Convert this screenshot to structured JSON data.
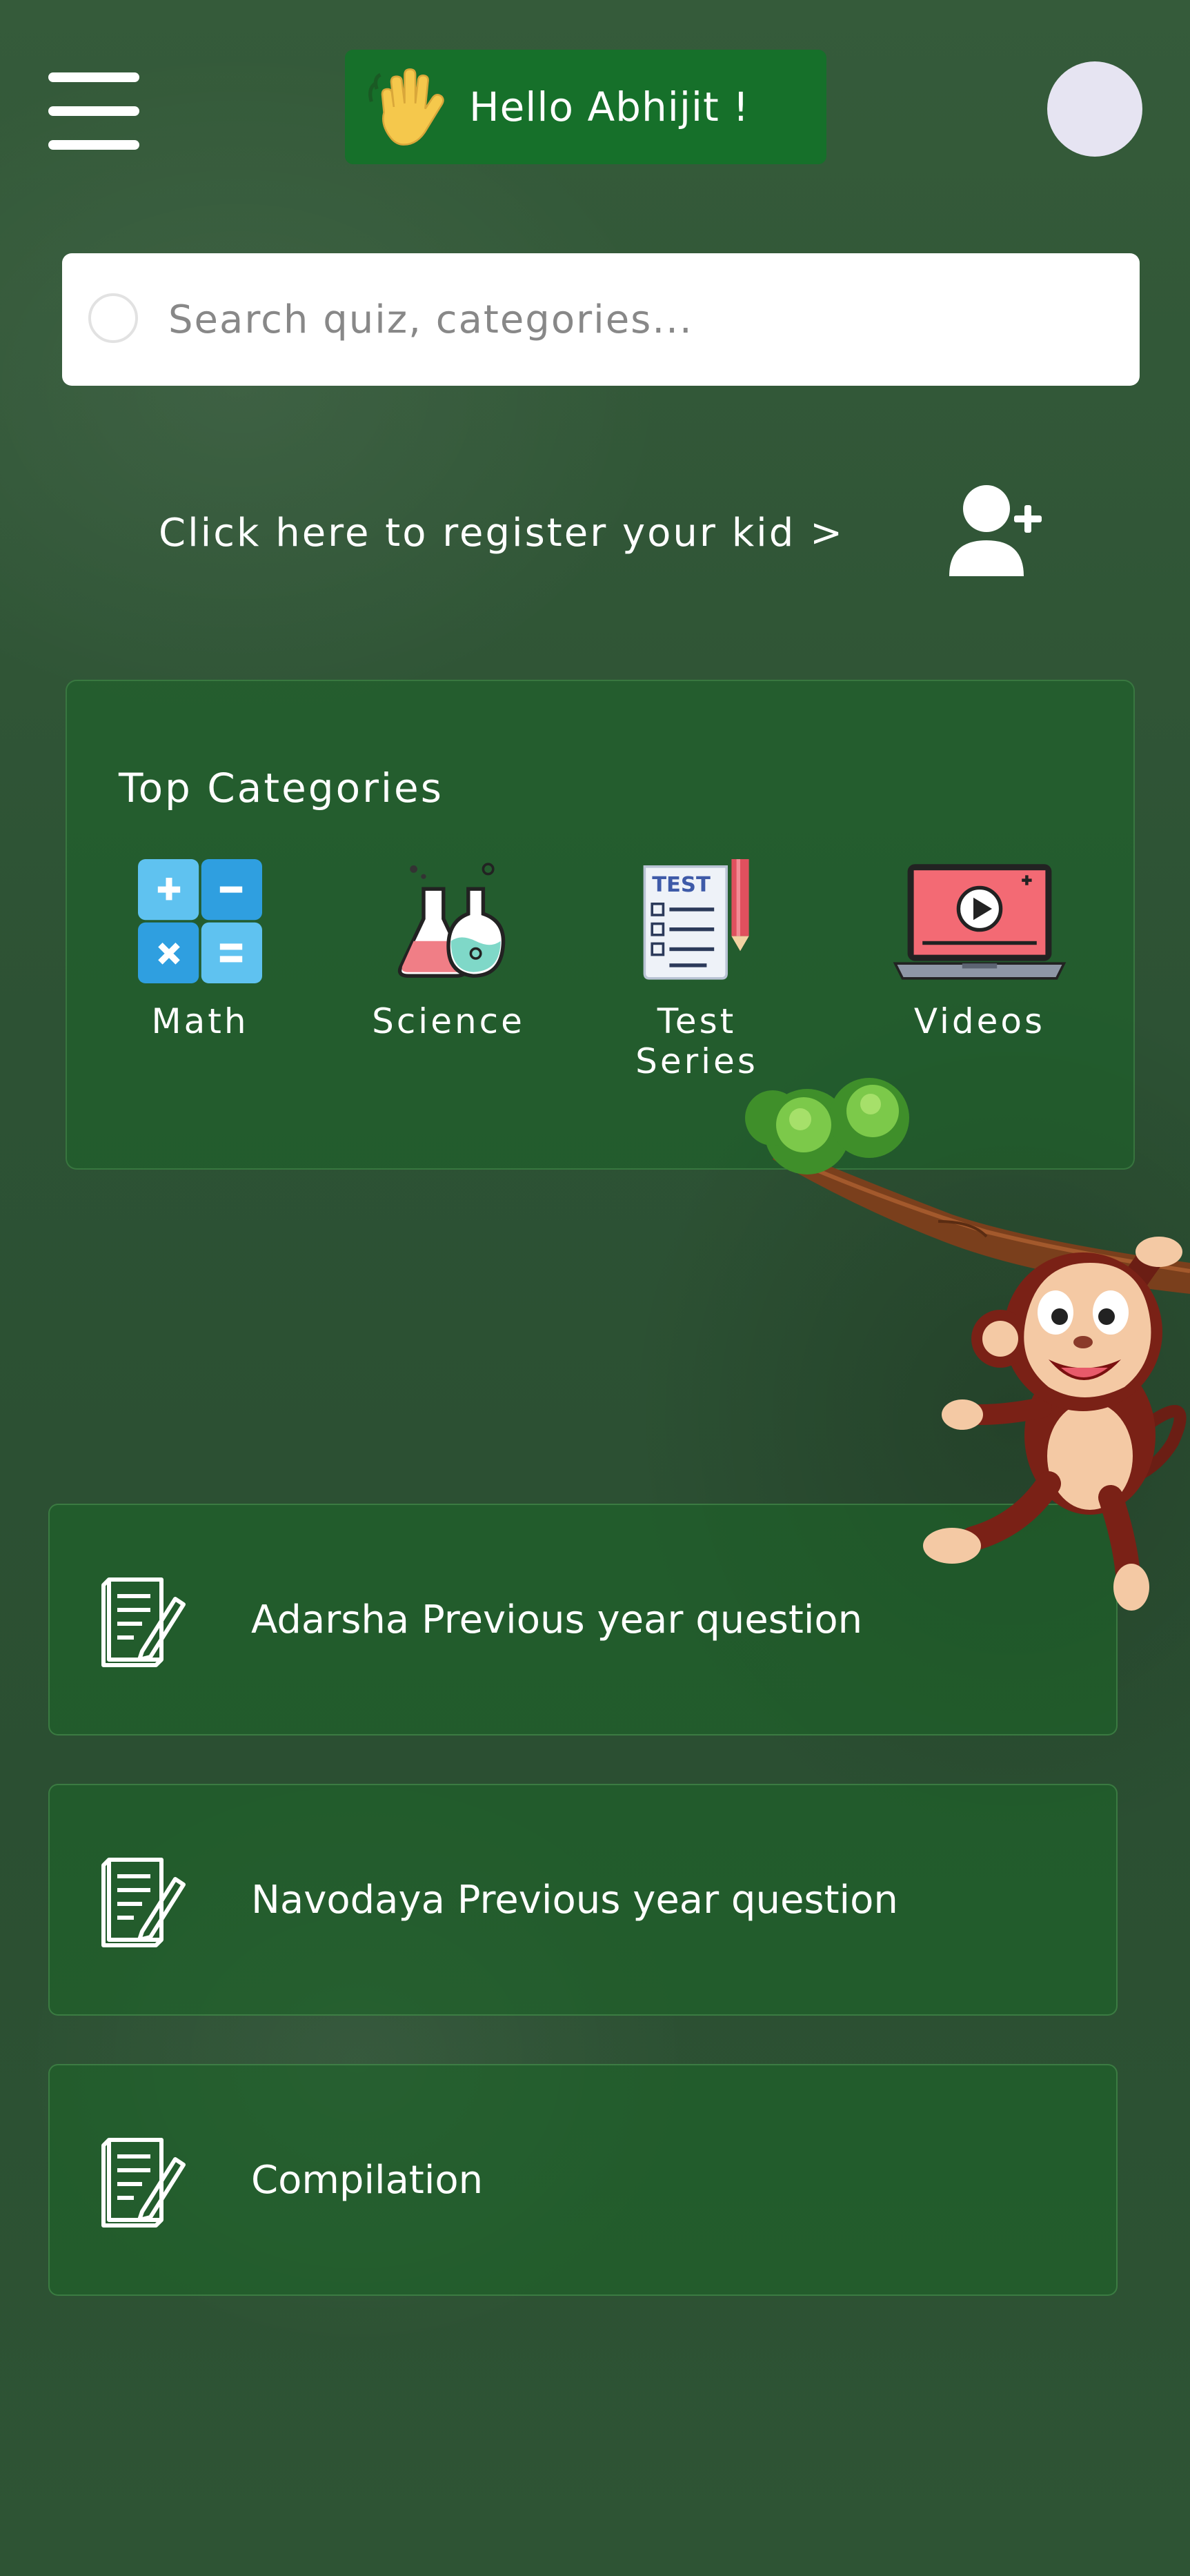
{
  "header": {
    "greeting": "Hello Abhijit !",
    "menu_icon": "hamburger-menu-icon",
    "wave_icon": "waving-hand-icon",
    "avatar_color": "#e6e4f2",
    "greeting_bg": "#16702a"
  },
  "search": {
    "placeholder": "Search quiz, categories..."
  },
  "register": {
    "label": "Click here to register your kid >",
    "icon": "add-user-icon"
  },
  "categories": {
    "title": "Top Categories",
    "items": [
      {
        "label": "Math",
        "icon": "calculator-icon"
      },
      {
        "label": "Science",
        "icon": "flask-icon"
      },
      {
        "label": "Test Series",
        "icon": "test-sheet-icon"
      },
      {
        "label": "Videos",
        "icon": "video-laptop-icon"
      }
    ],
    "test_badge": "TEST"
  },
  "list": [
    {
      "label": "Adarsha Previous year question",
      "icon": "document-edit-icon"
    },
    {
      "label": "Navodaya Previous year question",
      "icon": "document-edit-icon"
    },
    {
      "label": "Compilation",
      "icon": "document-edit-icon"
    }
  ]
}
